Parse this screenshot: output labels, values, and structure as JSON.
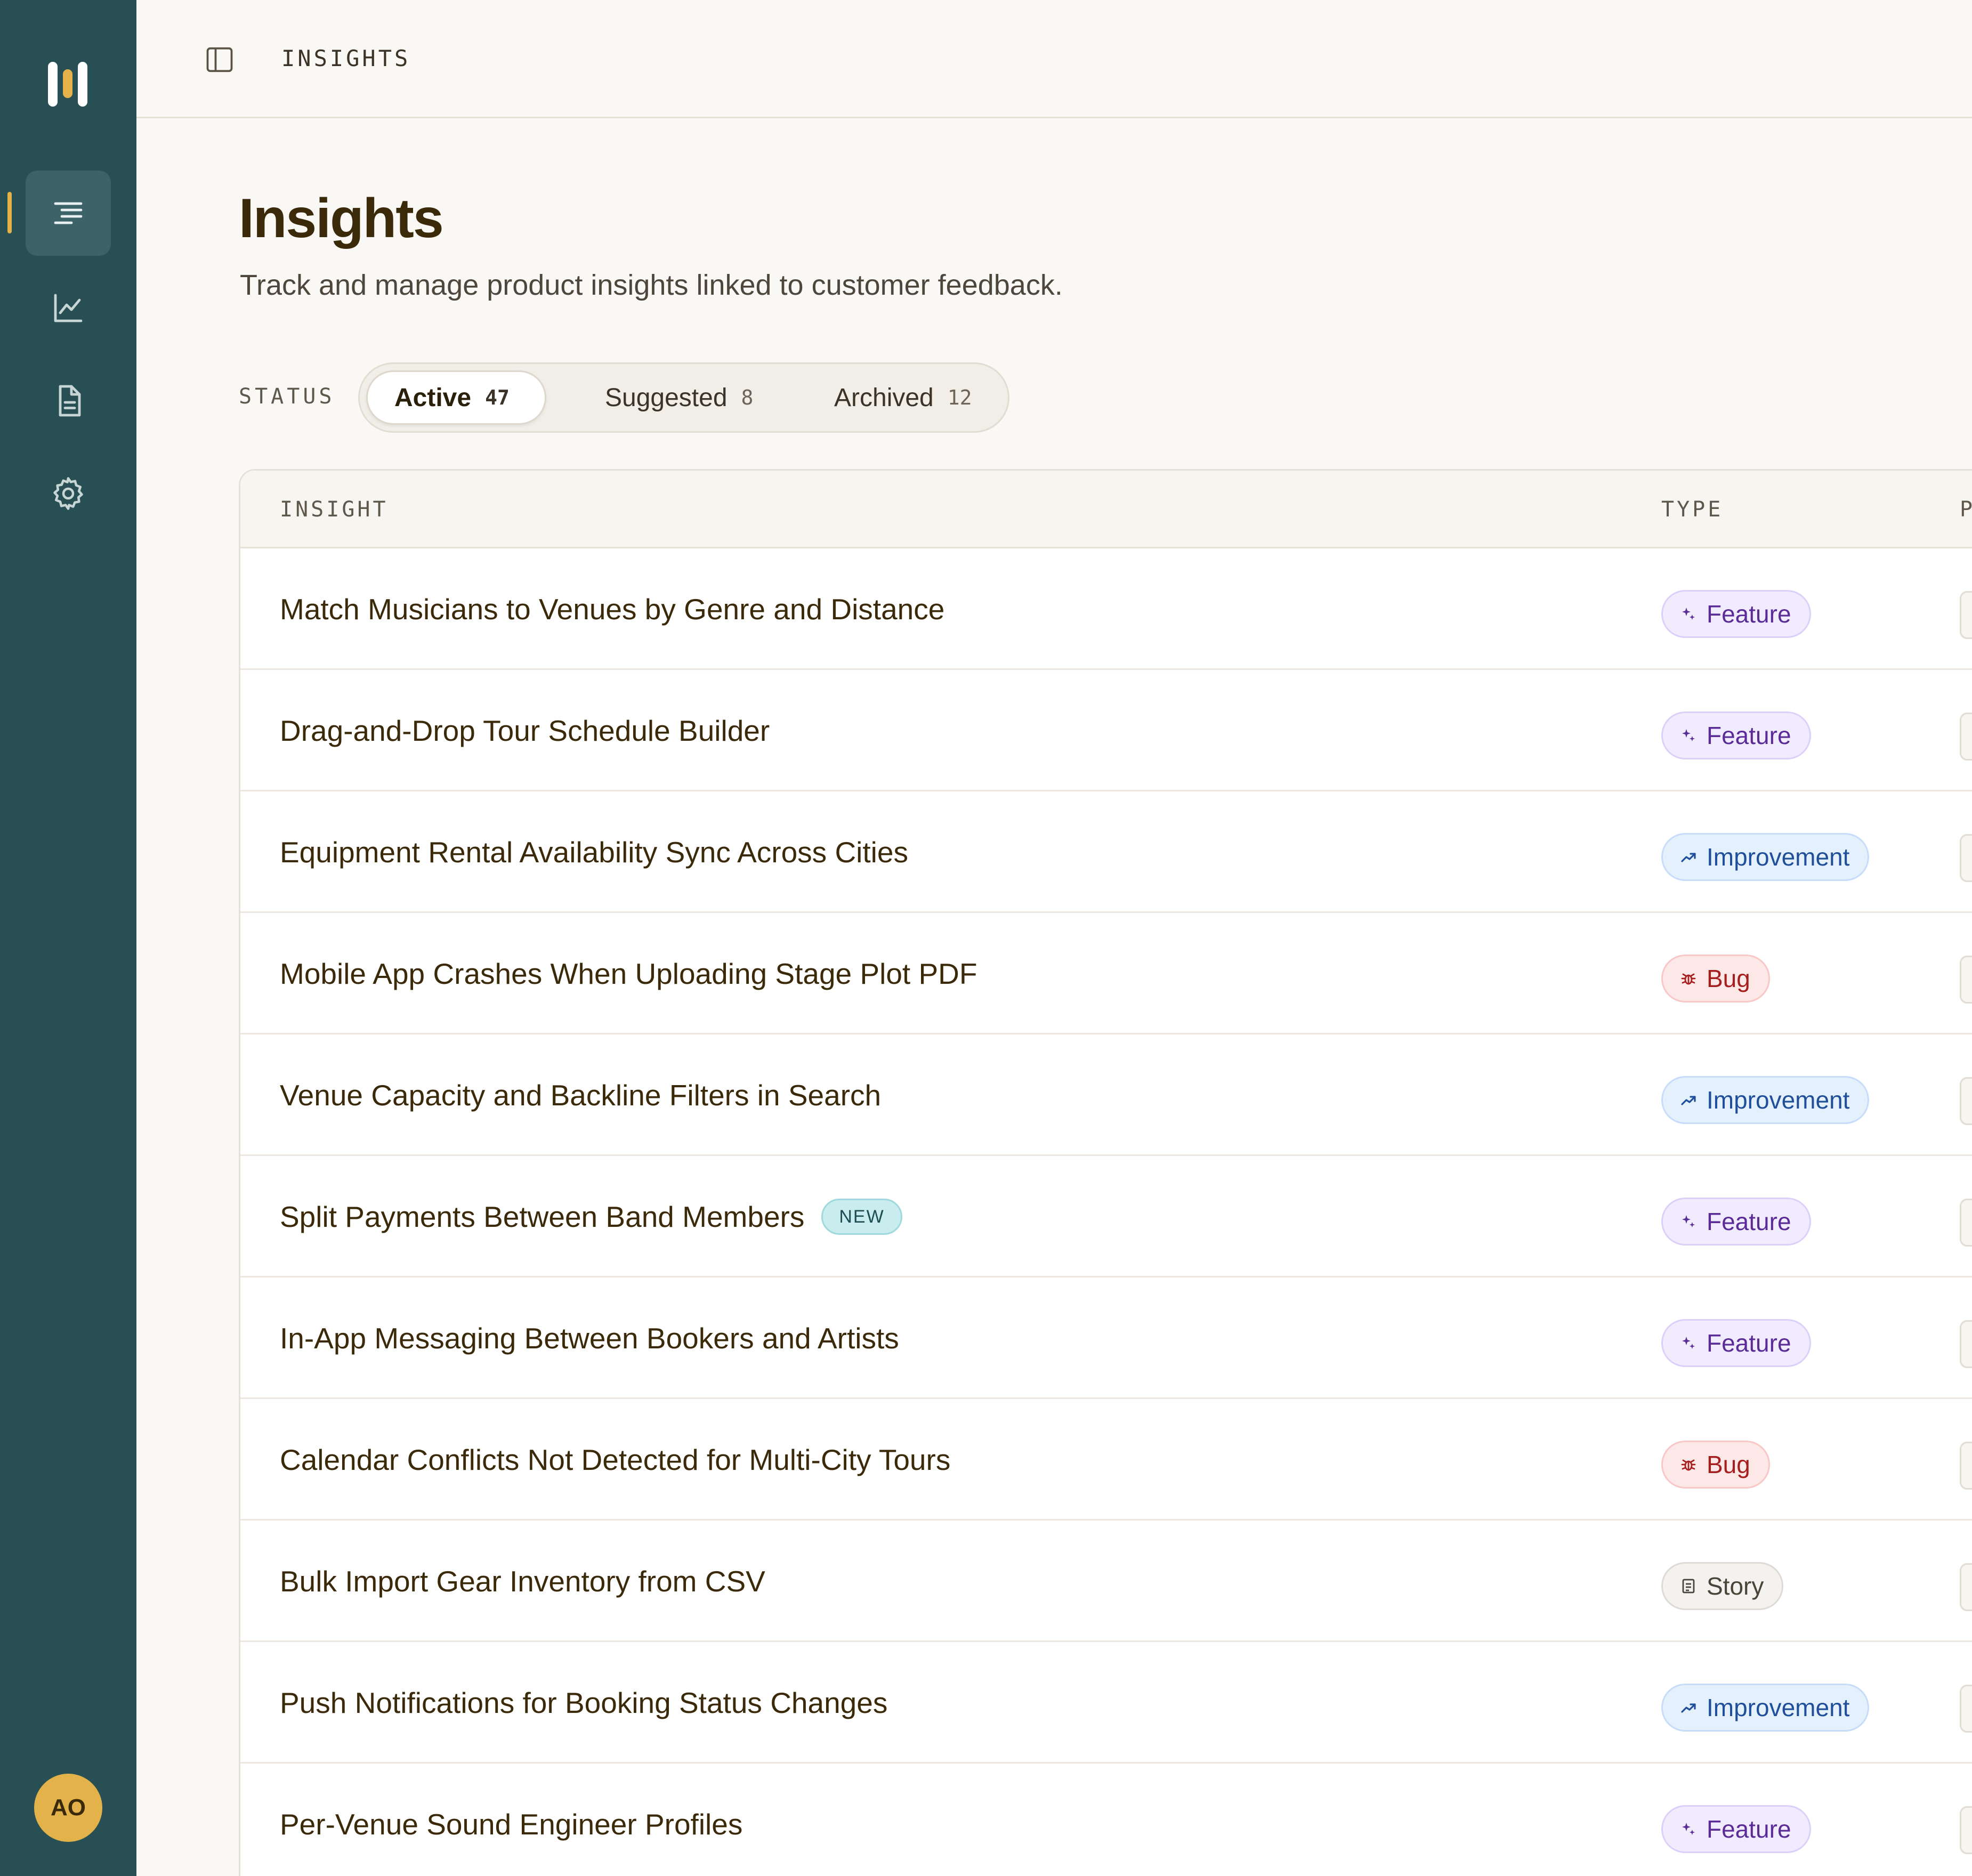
{
  "header": {
    "breadcrumb": "INSIGHTS"
  },
  "page": {
    "title": "Insights",
    "subtitle": "Track and manage product insights linked to customer feedback."
  },
  "status": {
    "label": "STATUS",
    "tabs": [
      {
        "label": "Active",
        "count": "47",
        "active": true
      },
      {
        "label": "Suggested",
        "count": "8",
        "active": false
      },
      {
        "label": "Archived",
        "count": "12",
        "active": false
      }
    ]
  },
  "table": {
    "columns": [
      "INSIGHT",
      "TYPE",
      "P"
    ],
    "rows": [
      {
        "title": "Match Musicians to Venues by Genre and Distance",
        "type": "Feature",
        "badge": ""
      },
      {
        "title": "Drag-and-Drop Tour Schedule Builder",
        "type": "Feature",
        "badge": ""
      },
      {
        "title": "Equipment Rental Availability Sync Across Cities",
        "type": "Improvement",
        "badge": ""
      },
      {
        "title": "Mobile App Crashes When Uploading Stage Plot PDF",
        "type": "Bug",
        "badge": ""
      },
      {
        "title": "Venue Capacity and Backline Filters in Search",
        "type": "Improvement",
        "badge": ""
      },
      {
        "title": "Split Payments Between Band Members",
        "type": "Feature",
        "badge": "NEW"
      },
      {
        "title": "In-App Messaging Between Bookers and Artists",
        "type": "Feature",
        "badge": ""
      },
      {
        "title": "Calendar Conflicts Not Detected for Multi-City Tours",
        "type": "Bug",
        "badge": ""
      },
      {
        "title": "Bulk Import Gear Inventory from CSV",
        "type": "Story",
        "badge": ""
      },
      {
        "title": "Push Notifications for Booking Status Changes",
        "type": "Improvement",
        "badge": ""
      },
      {
        "title": "Per-Venue Sound Engineer Profiles",
        "type": "Feature",
        "badge": ""
      }
    ]
  },
  "user": {
    "initials": "AO"
  },
  "icons": {
    "feature": "sparkle-icon",
    "improvement": "trend-up-icon",
    "bug": "bug-icon",
    "story": "document-icon"
  },
  "colors": {
    "sidebar": "#284f53",
    "accent": "#e3b24a",
    "feature": "#5b2c98",
    "improvement": "#1f4f9a",
    "bug": "#a61f1f",
    "story": "#4a4438"
  }
}
